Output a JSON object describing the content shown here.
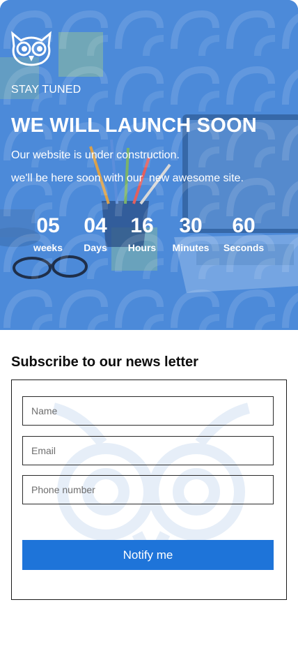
{
  "hero": {
    "eyebrow": "STAY TUNED",
    "headline": "WE WILL LAUNCH SOON",
    "description_line1": "Our website is under construction.",
    "description_line2": "we'll be here soon with our  new awesome site.",
    "background_color": "#4a88d9",
    "logo_icon": "owl-logo-icon"
  },
  "countdown": {
    "weeks": {
      "value": "05",
      "label": "weeks"
    },
    "days": {
      "value": "04",
      "label": "Days"
    },
    "hours": {
      "value": "16",
      "label": "Hours"
    },
    "minutes": {
      "value": "30",
      "label": "Minutes"
    },
    "seconds": {
      "value": "60",
      "label": "Seconds"
    }
  },
  "subscribe": {
    "title": "Subscribe to our news letter",
    "name_placeholder": "Name",
    "email_placeholder": "Email",
    "phone_placeholder": "Phone number",
    "button_label": "Notify me",
    "button_color": "#1e74d9"
  }
}
